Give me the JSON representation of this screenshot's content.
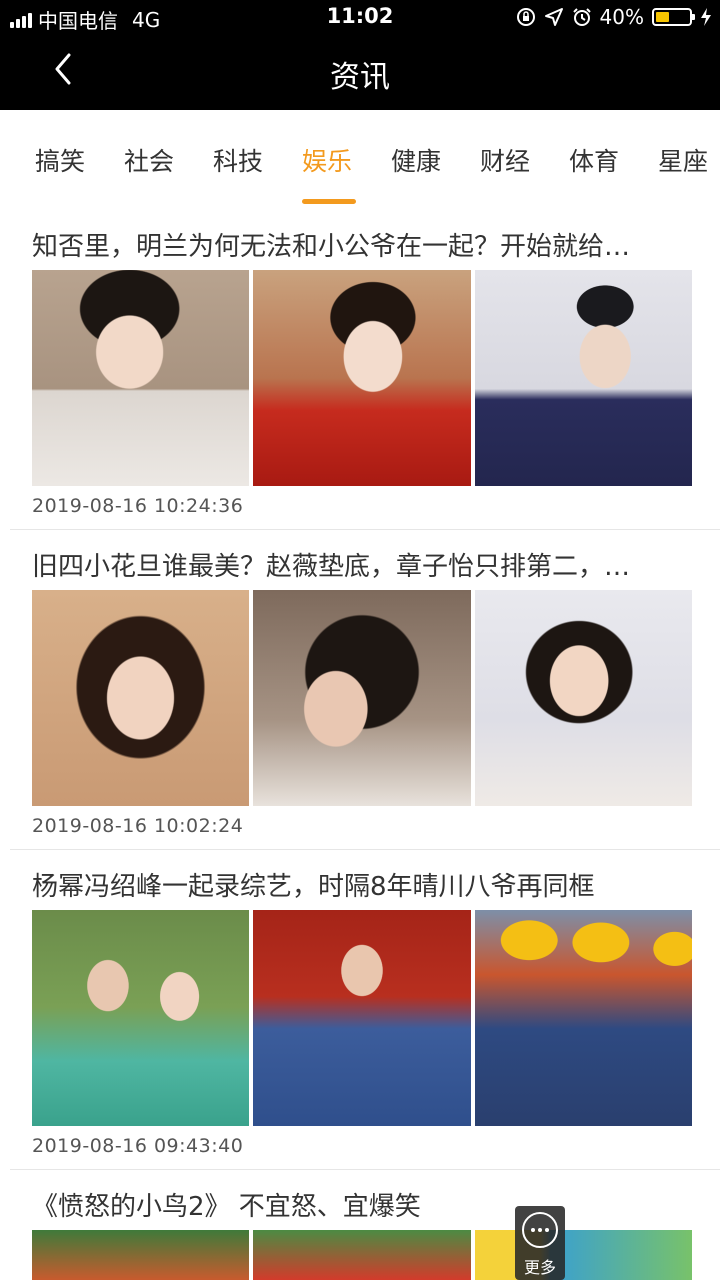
{
  "status_bar": {
    "carrier": "中国电信",
    "network": "4G",
    "time": "11:02",
    "battery_percent": "40%",
    "battery_level": 0.4,
    "icons": [
      "signal-icon",
      "rotation-lock-icon",
      "location-icon",
      "alarm-icon",
      "battery-icon",
      "charging-icon"
    ]
  },
  "nav": {
    "title": "资讯",
    "back_icon": "chevron-left-icon"
  },
  "tabs": {
    "items": [
      "搞笑",
      "社会",
      "科技",
      "娱乐",
      "健康",
      "财经",
      "体育",
      "星座"
    ],
    "active_index": 3,
    "active_color": "#f39a1e"
  },
  "feed": {
    "items": [
      {
        "title": "知否里，明兰为何无法和小公爷在一起？开始就给…",
        "time": "2019-08-16 10:24:36"
      },
      {
        "title": "旧四小花旦谁最美？赵薇垫底，章子怡只排第二，…",
        "time": "2019-08-16 10:02:24"
      },
      {
        "title": "杨幂冯绍峰一起录综艺，时隔8年晴川八爷再同框",
        "time": "2019-08-16 09:43:40"
      },
      {
        "title": "《愤怒的小鸟2》 不宜怒、宜爆笑"
      }
    ]
  },
  "more_button": {
    "label": "更多",
    "icon": "more-dots-icon"
  }
}
